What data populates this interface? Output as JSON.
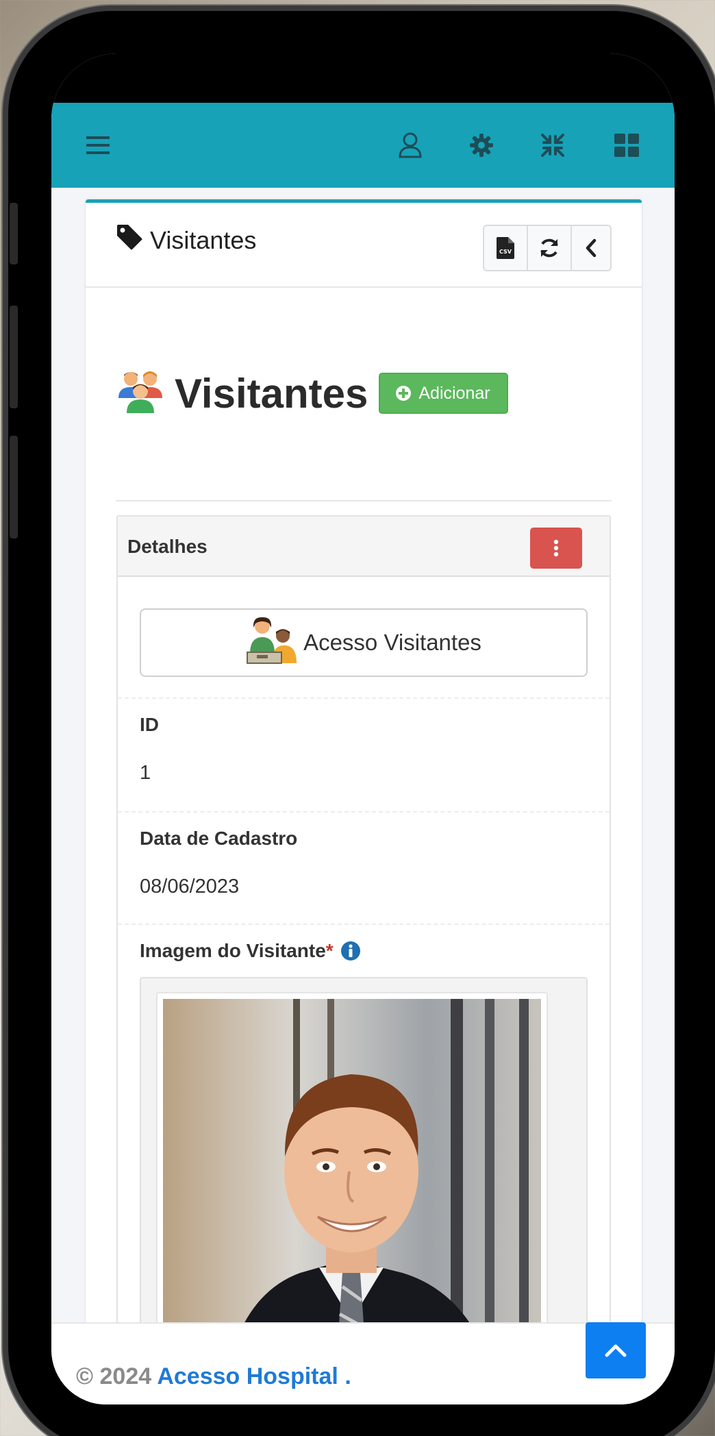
{
  "topbar": {
    "color": "#17a2b8",
    "icons": [
      "menu-icon",
      "user-icon",
      "gear-icon",
      "compress-icon",
      "grid-icon"
    ]
  },
  "card": {
    "title": "Visitantes",
    "tools": [
      "csv-file-icon",
      "refresh-icon",
      "chevron-left-icon"
    ]
  },
  "page": {
    "heading": "Visitantes",
    "add_button": "Adicionar"
  },
  "details": {
    "title": "Detalhes",
    "access_button": "Acesso Visitantes",
    "fields": {
      "id_label": "ID",
      "id_value": "1",
      "date_label": "Data de Cadastro",
      "date_value": "08/06/2023",
      "image_label": "Imagem do Visitante",
      "required_mark": "*"
    }
  },
  "footer": {
    "copyright": "© 2024",
    "brand": "Acesso Hospital",
    "suffix": "."
  }
}
